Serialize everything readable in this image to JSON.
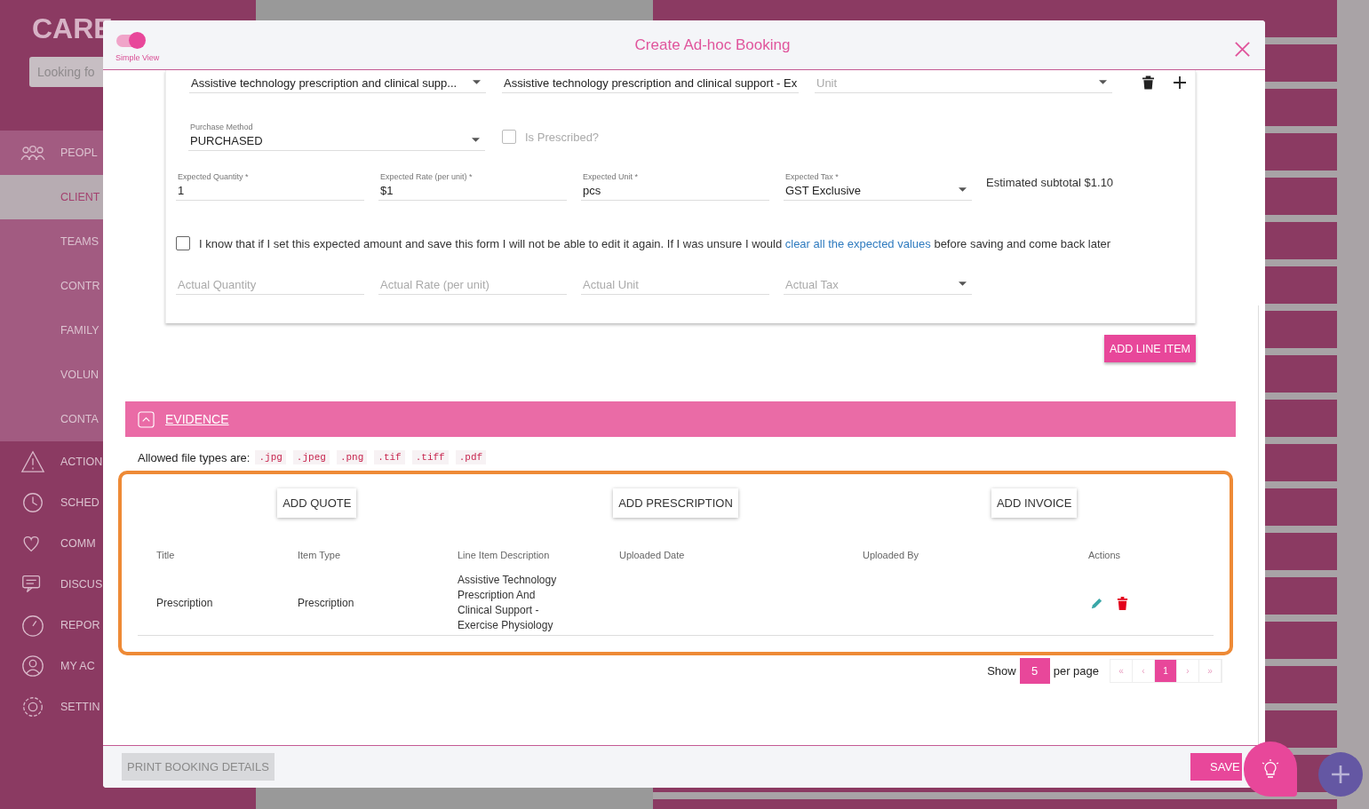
{
  "sidebar": {
    "logo": "CARE",
    "search": {
      "placeholder": "Looking fo"
    },
    "items": [
      {
        "label": "PEOPL",
        "selected": false,
        "children": [
          {
            "label": "CLIENT",
            "selected": true
          },
          {
            "label": "TEAMS",
            "selected": false
          },
          {
            "label": "CONTR",
            "selected": false
          },
          {
            "label": "FAMILY",
            "selected": false
          },
          {
            "label": "VOLUN",
            "selected": false
          },
          {
            "label": "CONTA",
            "selected": false
          }
        ]
      },
      {
        "label": "ACTION",
        "selected": false
      },
      {
        "label": "SCHED",
        "selected": false
      },
      {
        "label": "COMM",
        "selected": false
      },
      {
        "label": "DISCUS",
        "selected": false
      },
      {
        "label": "REPOR",
        "selected": false
      },
      {
        "label": "MY AC",
        "selected": false
      },
      {
        "label": "SETTIN",
        "selected": false
      }
    ]
  },
  "modal": {
    "title": "Create Ad-hoc Booking",
    "simple_view": {
      "label": "Simple View",
      "on": true
    },
    "line_item": {
      "row_1": [
        {
          "kind": "select",
          "value": "Assistive technology prescription and clinical supp..."
        },
        {
          "kind": "text",
          "value": "Assistive technology prescription and clinical support - Ex"
        },
        {
          "kind": "select",
          "placeholder": "Unit"
        }
      ],
      "purchase_method": {
        "kind": "select",
        "label": "Purchase Method",
        "value": "PURCHASED"
      },
      "is_prescribed": {
        "label": "Is Prescribed?",
        "checked": false,
        "disabled": true
      },
      "expected": [
        {
          "kind": "text",
          "label": "Expected Quantity *",
          "value": "1"
        },
        {
          "kind": "text",
          "label": "Expected Rate (per unit) *",
          "value": "$1"
        },
        {
          "kind": "text",
          "label": "Expected Unit *",
          "value": "pcs"
        },
        {
          "kind": "select",
          "label": "Expected Tax *",
          "value": "GST Exclusive"
        }
      ],
      "subtotal": "Estimated subtotal $1.10",
      "confirm": {
        "checked": false,
        "text_before": "I know that if I set this expected amount and save this form I will not be able to edit it again. If I was unsure I would",
        "link": "clear all the expected values",
        "text_after": "before saving and come back later"
      },
      "actual": [
        {
          "kind": "text",
          "placeholder": "Actual Quantity"
        },
        {
          "kind": "text",
          "placeholder": "Actual Rate (per unit)"
        },
        {
          "kind": "text",
          "placeholder": "Actual Unit"
        },
        {
          "kind": "select",
          "placeholder": "Actual Tax"
        }
      ]
    },
    "add_line_item": "ADD LINE ITEM",
    "evidence": {
      "title": "EVIDENCE",
      "expanded": true,
      "allowed_label": "Allowed file types are:",
      "file_types": [
        ".jpg",
        ".jpeg",
        ".png",
        ".tif",
        ".tiff",
        ".pdf"
      ],
      "buttons": [
        "ADD QUOTE",
        "ADD PRESCRIPTION",
        "ADD INVOICE"
      ],
      "columns": [
        "Title",
        "Item Type",
        "Line Item Description",
        "Uploaded Date",
        "Uploaded By",
        "Actions"
      ],
      "rows": [
        {
          "title": "Prescription",
          "item_type": "Prescription",
          "description": "Assistive Technology Prescription And Clinical Support - Exercise Physiology"
        }
      ],
      "pagination": {
        "show_label": "Show",
        "page_size": "5",
        "per_page_label": "per page",
        "pages": [
          {
            "label": "«",
            "selected": false
          },
          {
            "label": "‹",
            "selected": false
          },
          {
            "label": "1",
            "selected": true
          },
          {
            "label": "›",
            "selected": false
          },
          {
            "label": "»",
            "selected": false
          }
        ]
      }
    },
    "footer": {
      "print_button": {
        "label": "PRINT BOOKING DETAILS",
        "disabled": true
      },
      "save_button": "SAVE"
    }
  }
}
